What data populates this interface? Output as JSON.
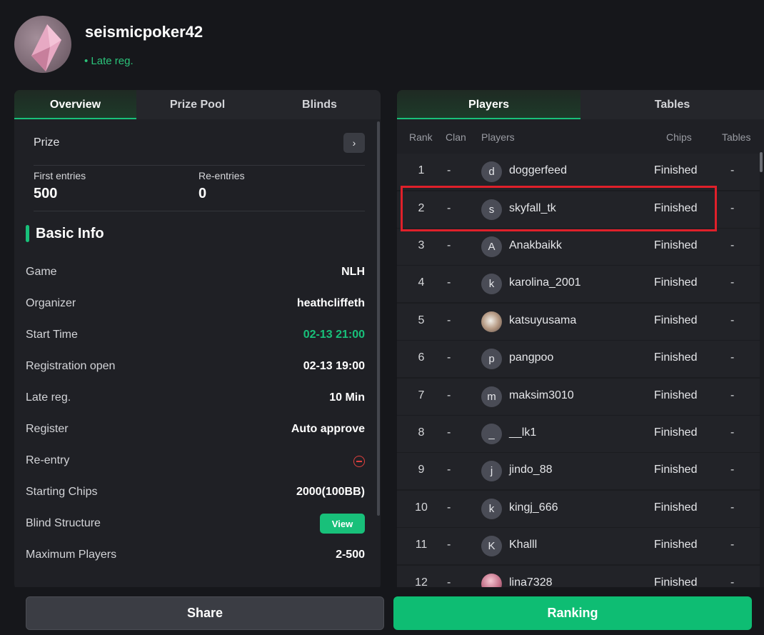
{
  "profile": {
    "username": "seismicpoker42",
    "status": "• Late reg."
  },
  "left_tabs": [
    "Overview",
    "Prize Pool",
    "Blinds"
  ],
  "prize": {
    "label": "Prize",
    "chevron": "›"
  },
  "entries": {
    "first_label": "First entries",
    "first_value": "500",
    "re_label": "Re-entries",
    "re_value": "0"
  },
  "basic_info": {
    "title": "Basic Info",
    "rows": [
      {
        "key": "Game",
        "value": "NLH"
      },
      {
        "key": "Organizer",
        "value": "heathcliffeth"
      },
      {
        "key": "Start Time",
        "value": "02-13 21:00"
      },
      {
        "key": "Registration open",
        "value": "02-13 19:00"
      },
      {
        "key": "Late reg.",
        "value": "10 Min"
      },
      {
        "key": "Register",
        "value": "Auto approve"
      },
      {
        "key": "Re-entry",
        "value": "minus-circle-icon"
      },
      {
        "key": "Starting Chips",
        "value": "2000(100BB)"
      },
      {
        "key": "Blind Structure",
        "value": "View"
      },
      {
        "key": "Maximum Players",
        "value": "2-500"
      }
    ]
  },
  "right_tabs": [
    "Players",
    "Tables"
  ],
  "table_headers": [
    "Rank",
    "Clan",
    "Players",
    "Chips",
    "Tables"
  ],
  "players": [
    {
      "rank": "1",
      "clan": "-",
      "initial": "d",
      "name": "doggerfeed",
      "chips": "Finished",
      "tables": "-"
    },
    {
      "rank": "2",
      "clan": "-",
      "initial": "s",
      "name": "skyfall_tk",
      "chips": "Finished",
      "tables": "-"
    },
    {
      "rank": "3",
      "clan": "-",
      "initial": "A",
      "name": "Anakbaikk",
      "chips": "Finished",
      "tables": "-"
    },
    {
      "rank": "4",
      "clan": "-",
      "initial": "k",
      "name": "karolina_2001",
      "chips": "Finished",
      "tables": "-"
    },
    {
      "rank": "5",
      "clan": "-",
      "initial": "",
      "name": "katsuyusama",
      "chips": "Finished",
      "tables": "-"
    },
    {
      "rank": "6",
      "clan": "-",
      "initial": "p",
      "name": "pangpoo",
      "chips": "Finished",
      "tables": "-"
    },
    {
      "rank": "7",
      "clan": "-",
      "initial": "m",
      "name": "maksim3010",
      "chips": "Finished",
      "tables": "-"
    },
    {
      "rank": "8",
      "clan": "-",
      "initial": "_",
      "name": "__lk1",
      "chips": "Finished",
      "tables": "-"
    },
    {
      "rank": "9",
      "clan": "-",
      "initial": "j",
      "name": "jindo_88",
      "chips": "Finished",
      "tables": "-"
    },
    {
      "rank": "10",
      "clan": "-",
      "initial": "k",
      "name": "kingj_666",
      "chips": "Finished",
      "tables": "-"
    },
    {
      "rank": "11",
      "clan": "-",
      "initial": "K",
      "name": "Khalll",
      "chips": "Finished",
      "tables": "-"
    },
    {
      "rank": "12",
      "clan": "-",
      "initial": "",
      "name": "lina7328",
      "chips": "Finished",
      "tables": "-"
    }
  ],
  "buttons": {
    "share": "Share",
    "ranking": "Ranking"
  },
  "colors": {
    "accent": "#18c07a",
    "highlight": "#e0202a",
    "background": "#16171b"
  }
}
